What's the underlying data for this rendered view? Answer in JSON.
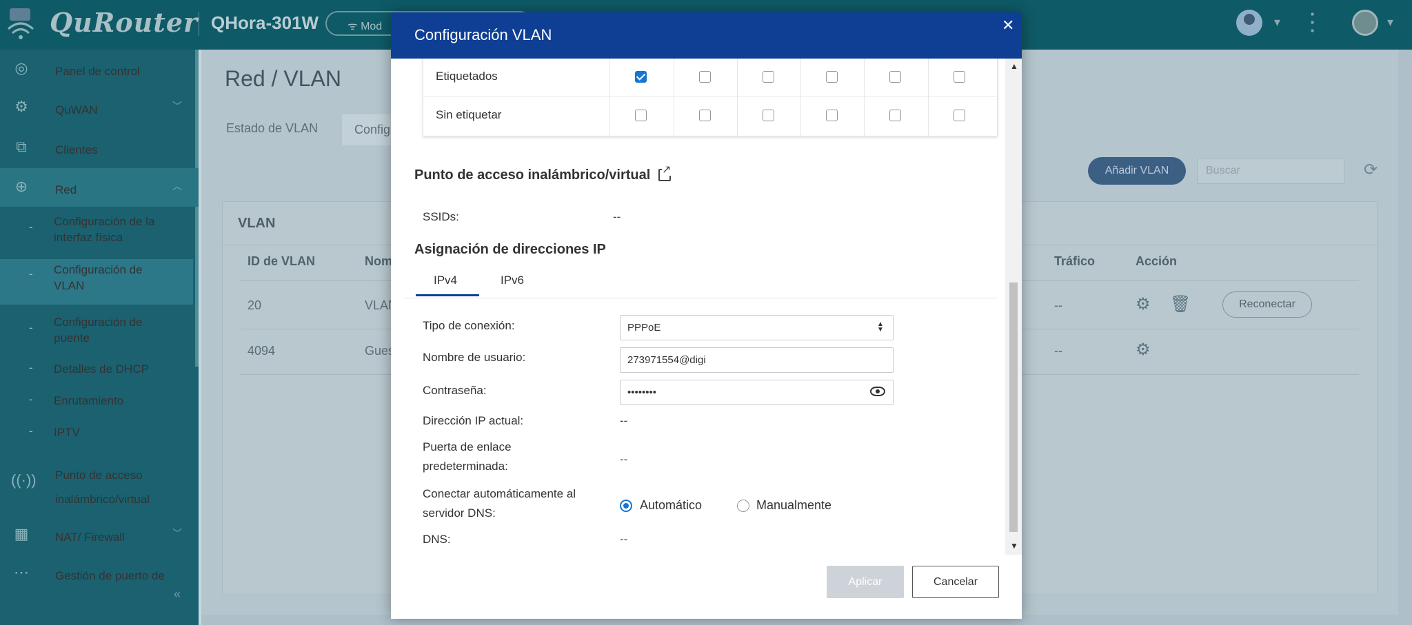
{
  "topbar": {
    "brand": "QuRouter",
    "model": "QHora-301W",
    "mode_label": "Mod"
  },
  "sidebar": {
    "items": [
      {
        "label": "Panel de control",
        "icon": "dashboard-icon"
      },
      {
        "label": "QuWAN",
        "icon": "quwan-icon"
      },
      {
        "label": "Clientes",
        "icon": "clients-icon"
      },
      {
        "label": "Red",
        "icon": "globe-icon"
      },
      {
        "label": "Punto de acceso inalámbrico/virtual",
        "icon": "wireless-icon"
      },
      {
        "label": "NAT/ Firewall",
        "icon": "firewall-icon"
      },
      {
        "label": "Gestión de puerto de",
        "icon": "port-icon"
      }
    ],
    "sub_items": [
      "Configuración de la interfaz física",
      "Configuración de VLAN",
      "Configuración de puente",
      "Detalles de DHCP",
      "Enrutamiento",
      "IPTV"
    ]
  },
  "main": {
    "title": "Red / VLAN",
    "tabs": [
      "Estado de VLAN",
      "Config"
    ],
    "add_button": "Añadir VLAN",
    "search_placeholder": "Buscar",
    "card_title": "VLAN",
    "columns": [
      "ID de VLAN",
      "Nom",
      "Tráfico",
      "Acción"
    ],
    "rows": [
      {
        "id": "20",
        "name": "VLAN",
        "traffic": "--"
      },
      {
        "id": "4094",
        "name": "Gues",
        "traffic": "--"
      }
    ],
    "reconnect": "Reconectar"
  },
  "modal": {
    "title": "Configuración VLAN",
    "ports": {
      "tagged_label": "Etiquetados",
      "untagged_label": "Sin etiquetar",
      "tagged": [
        true,
        false,
        false,
        false,
        false,
        false
      ],
      "untagged": [
        false,
        false,
        false,
        false,
        false,
        false
      ]
    },
    "wireless_title": "Punto de acceso inalámbrico/virtual",
    "ssids_label": "SSIDs:",
    "ssids_value": "--",
    "ip_title": "Asignación de direcciones IP",
    "ip_tabs": [
      "IPv4",
      "IPv6"
    ],
    "connection_type_label": "Tipo de conexión:",
    "connection_type_value": "PPPoE",
    "username_label": "Nombre de usuario:",
    "username_value": "273971554@digi",
    "password_label": "Contraseña:",
    "password_value": "••••••••",
    "current_ip_label": "Dirección IP actual:",
    "current_ip_value": "--",
    "gateway_label": "Puerta de enlace predeterminada:",
    "gateway_value": "--",
    "dns_auto_label": "Conectar automáticamente al servidor DNS:",
    "dns_options": [
      "Automático",
      "Manualmente"
    ],
    "dns_label": "DNS:",
    "dns_value": "--",
    "apply": "Aplicar",
    "cancel": "Cancelar"
  }
}
